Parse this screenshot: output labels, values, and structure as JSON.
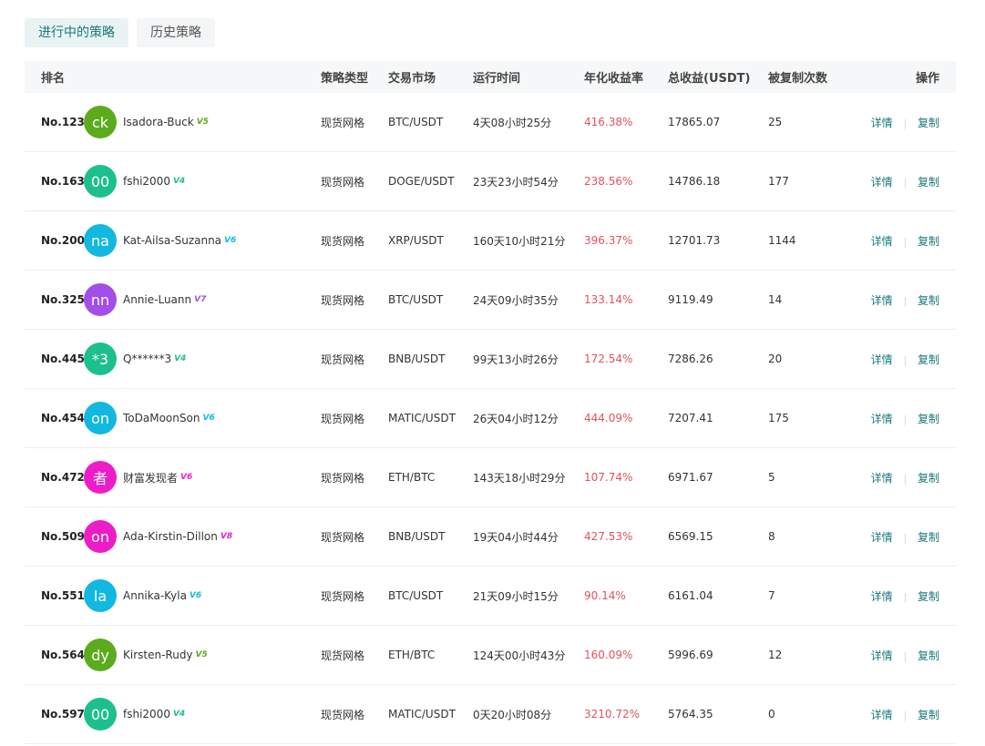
{
  "tabs": [
    {
      "label": "进行中的策略",
      "active": true
    },
    {
      "label": "历史策略",
      "active": false
    }
  ],
  "headers": {
    "rank": "排名",
    "type": "策略类型",
    "market": "交易市场",
    "time": "运行时间",
    "rate": "年化收益率",
    "profit": "总收益(USDT)",
    "copies": "被复制次数",
    "ops": "操作"
  },
  "actions": {
    "detail": "详情",
    "copy": "复制"
  },
  "rows": [
    {
      "rank": "No.123",
      "avatar": "ck",
      "avatar_color": "#5cab1c",
      "name": "Isadora-Buck",
      "badge": "V5",
      "badge_color": "#5cab1c",
      "type": "现货网格",
      "market": "BTC/USDT",
      "time": "4天08小时25分",
      "rate": "416.38%",
      "profit": "17865.07",
      "copies": "25"
    },
    {
      "rank": "No.163",
      "avatar": "00",
      "avatar_color": "#1dbf8d",
      "name": "fshi2000",
      "badge": "V4",
      "badge_color": "#1dbf8d",
      "type": "现货网格",
      "market": "DOGE/USDT",
      "time": "23天23小时54分",
      "rate": "238.56%",
      "profit": "14786.18",
      "copies": "177"
    },
    {
      "rank": "No.200",
      "avatar": "na",
      "avatar_color": "#12b8e0",
      "name": "Kat-Ailsa-Suzanna",
      "badge": "V6",
      "badge_color": "#12b8e0",
      "type": "现货网格",
      "market": "XRP/USDT",
      "time": "160天10小时21分",
      "rate": "396.37%",
      "profit": "12701.73",
      "copies": "1144"
    },
    {
      "rank": "No.325",
      "avatar": "nn",
      "avatar_color": "#a24ee8",
      "name": "Annie-Luann",
      "badge": "V7",
      "badge_color": "#a24ee8",
      "type": "现货网格",
      "market": "BTC/USDT",
      "time": "24天09小时35分",
      "rate": "133.14%",
      "profit": "9119.49",
      "copies": "14"
    },
    {
      "rank": "No.445",
      "avatar": "*3",
      "avatar_color": "#1dbf8d",
      "name": "Q******3",
      "badge": "V4",
      "badge_color": "#1dbf8d",
      "type": "现货网格",
      "market": "BNB/USDT",
      "time": "99天13小时26分",
      "rate": "172.54%",
      "profit": "7286.26",
      "copies": "20"
    },
    {
      "rank": "No.454",
      "avatar": "on",
      "avatar_color": "#12b8e0",
      "name": "ToDaMoonSon",
      "badge": "V6",
      "badge_color": "#12b8e0",
      "type": "现货网格",
      "market": "MATIC/USDT",
      "time": "26天04小时12分",
      "rate": "444.09%",
      "profit": "7207.41",
      "copies": "175"
    },
    {
      "rank": "No.472",
      "avatar": "者",
      "avatar_color": "#ee1cc8",
      "name": "财富发现者",
      "badge": "V6",
      "badge_color": "#ee1cc8",
      "type": "现货网格",
      "market": "ETH/BTC",
      "time": "143天18小时29分",
      "rate": "107.74%",
      "profit": "6971.67",
      "copies": "5"
    },
    {
      "rank": "No.509",
      "avatar": "on",
      "avatar_color": "#ee1cc8",
      "name": "Ada-Kirstin-Dillon",
      "badge": "V8",
      "badge_color": "#ee1cc8",
      "type": "现货网格",
      "market": "BNB/USDT",
      "time": "19天04小时44分",
      "rate": "427.53%",
      "profit": "6569.15",
      "copies": "8"
    },
    {
      "rank": "No.551",
      "avatar": "la",
      "avatar_color": "#12b8e0",
      "name": "Annika-Kyla",
      "badge": "V6",
      "badge_color": "#12b8e0",
      "type": "现货网格",
      "market": "BTC/USDT",
      "time": "21天09小时15分",
      "rate": "90.14%",
      "profit": "6161.04",
      "copies": "7"
    },
    {
      "rank": "No.564",
      "avatar": "dy",
      "avatar_color": "#5cab1c",
      "name": "Kirsten-Rudy",
      "badge": "V5",
      "badge_color": "#5cab1c",
      "type": "现货网格",
      "market": "ETH/BTC",
      "time": "124天00小时43分",
      "rate": "160.09%",
      "profit": "5996.69",
      "copies": "12"
    },
    {
      "rank": "No.597",
      "avatar": "00",
      "avatar_color": "#1dbf8d",
      "name": "fshi2000",
      "badge": "V4",
      "badge_color": "#1dbf8d",
      "type": "现货网格",
      "market": "MATIC/USDT",
      "time": "0天20小时08分",
      "rate": "3210.72%",
      "profit": "5764.35",
      "copies": "0"
    }
  ]
}
